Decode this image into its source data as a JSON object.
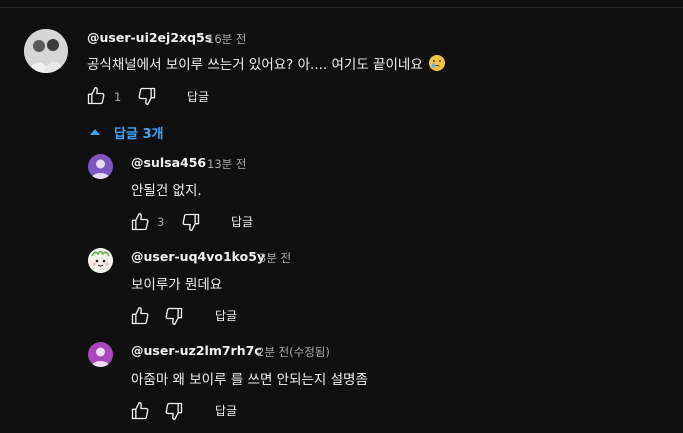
{
  "comment": {
    "author": "@user-ui2ej2xq5s",
    "time": "16분 전",
    "text": "공식채널에서 보이루 쓰는거 있어요? 아.... 여기도 끝이네요",
    "emoji": "😢",
    "likes": "1",
    "reply_label": "답글"
  },
  "replies_toggle": {
    "label": "답글 3개",
    "accent": "#3ea6ff"
  },
  "replies": [
    {
      "author": "@sulsa456",
      "time": "13분 전",
      "text": "안될건 없지.",
      "likes": "3",
      "reply_label": "답글",
      "avatar_color": "#7e57c2"
    },
    {
      "author": "@user-uq4vo1ko5y",
      "time": "3분 전",
      "text": "보이루가 뭔데요",
      "likes": "",
      "reply_label": "답글",
      "avatar_color": "#f4f4ec"
    },
    {
      "author": "@user-uz2lm7rh7c",
      "time": "2분 전(수정됨)",
      "text": "아줌마 왜  보이루 를 쓰면 안되는지 설명좀",
      "likes": "",
      "reply_label": "답글",
      "avatar_color": "#ab47bc"
    }
  ],
  "colors": {
    "background": "#0f0f0f",
    "text": "#f1f1f1",
    "secondary": "#aaaaaa"
  },
  "icons": [
    "thumb-up-icon",
    "thumb-down-icon",
    "caret-up-icon",
    "person-icon"
  ]
}
